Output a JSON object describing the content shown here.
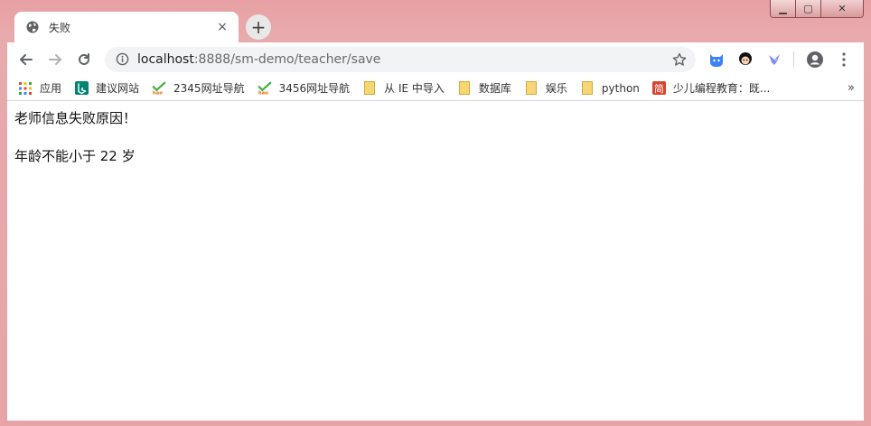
{
  "window": {
    "controls": {
      "minimize": "▁",
      "maximize": "▢",
      "close": "✕"
    }
  },
  "tab": {
    "title": "失败",
    "favicon": "globe-icon",
    "close": "×"
  },
  "newtab": {
    "label": "+"
  },
  "toolbar": {
    "url_host": "localhost",
    "url_rest": ":8888/sm-demo/teacher/save",
    "icons": [
      "back-icon",
      "forward-icon",
      "reload-icon",
      "info-icon",
      "star-icon",
      "account-icon",
      "menu-icon"
    ]
  },
  "bookmarks": {
    "items": [
      {
        "label": "应用",
        "icon": "apps-grid-icon"
      },
      {
        "label": "建议网站",
        "icon": "bing-icon"
      },
      {
        "label": "2345网址导航",
        "icon": "hao-icon"
      },
      {
        "label": "3456网址导航",
        "icon": "hao-icon"
      },
      {
        "label": "从 IE 中导入",
        "icon": "folder-icon"
      },
      {
        "label": "数据库",
        "icon": "folder-icon"
      },
      {
        "label": "娱乐",
        "icon": "folder-icon"
      },
      {
        "label": "python",
        "icon": "folder-icon"
      },
      {
        "label": "少儿编程教育：既...",
        "icon": "jian-icon"
      }
    ],
    "jian_char": "简",
    "more": "»"
  },
  "page": {
    "line1": "老师信息失败原因！",
    "line2": "年龄不能小于 22 岁"
  },
  "colors": {
    "folder": "#f7d774",
    "bing": "#008373",
    "hao_check": "#3db33d",
    "hao_text": "#e86a10",
    "jian": "#d9432f",
    "ext_blue": "#3b82f6"
  }
}
